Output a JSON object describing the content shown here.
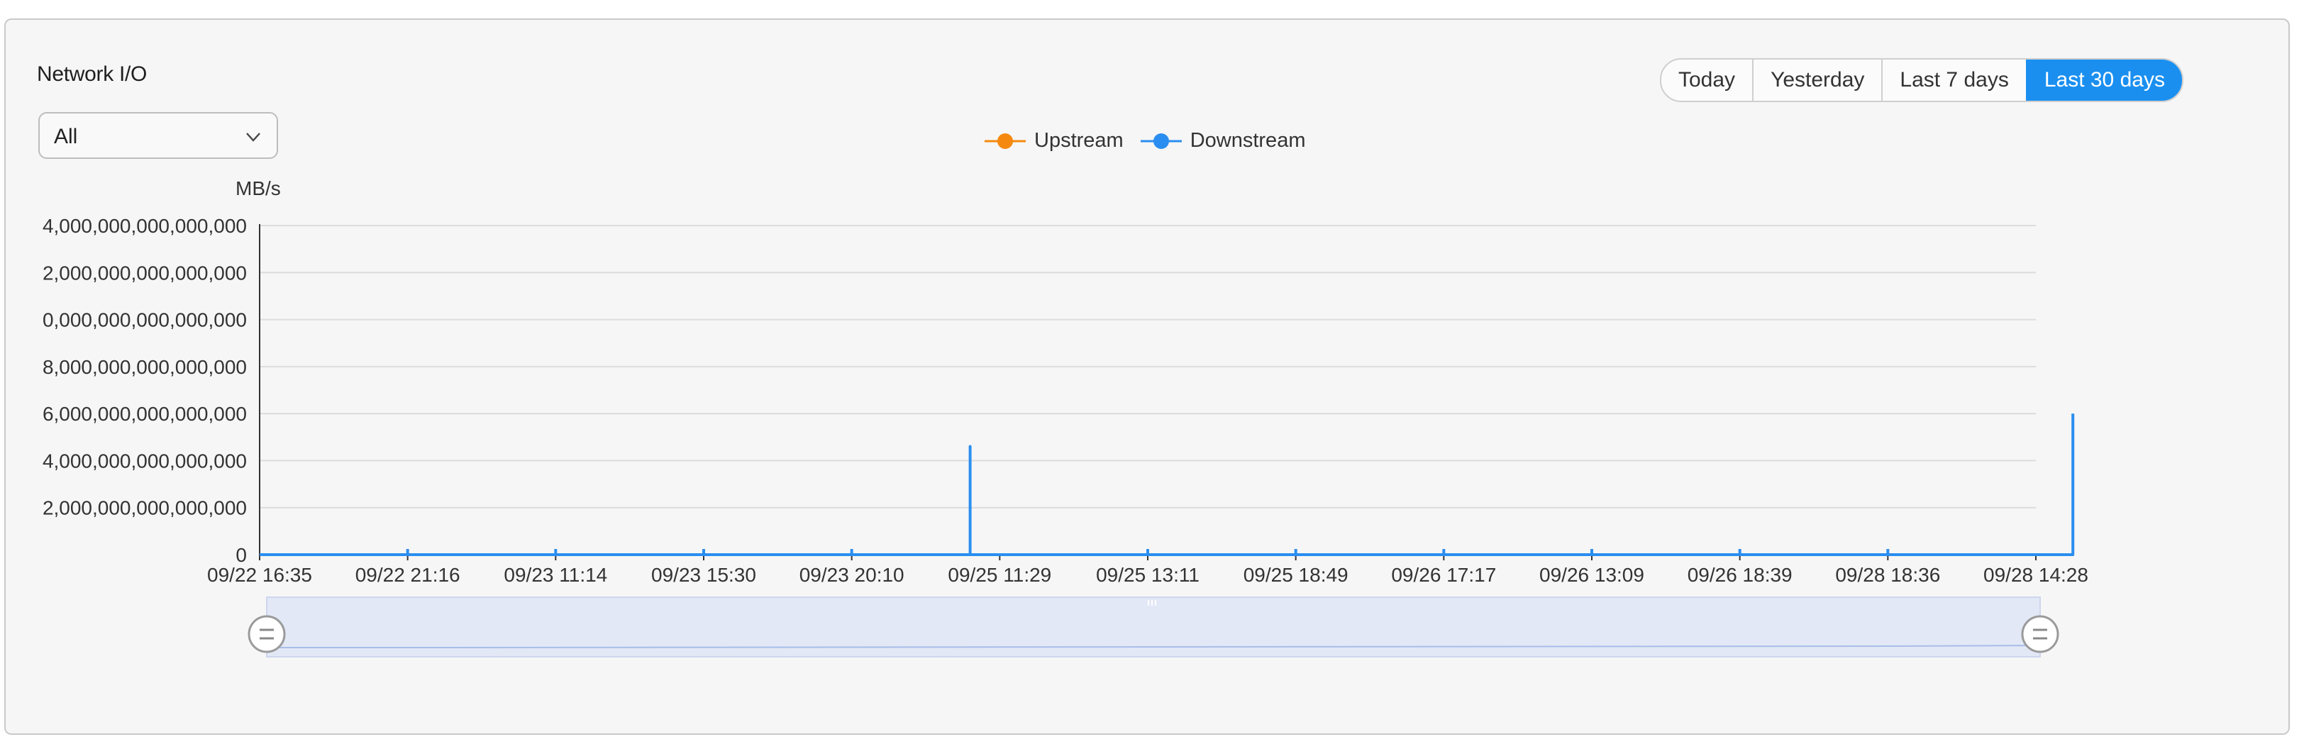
{
  "panel": {
    "title": "Network I/O",
    "filter": {
      "selected": "All"
    },
    "time_ranges": [
      {
        "label": "Today",
        "active": false
      },
      {
        "label": "Yesterday",
        "active": false
      },
      {
        "label": "Last 7 days",
        "active": false
      },
      {
        "label": "Last 30 days",
        "active": true
      }
    ]
  },
  "chart_data": {
    "type": "line",
    "unit_label": "MB/s",
    "y_tick_labels": [
      "4,000,000,000,000,000",
      "2,000,000,000,000,000",
      "0,000,000,000,000,000",
      "8,000,000,000,000,000",
      "6,000,000,000,000,000",
      "4,000,000,000,000,000",
      "2,000,000,000,000,000",
      "0"
    ],
    "x_tick_labels": [
      "09/22 16:35",
      "09/22 21:16",
      "09/23 11:14",
      "09/23 15:30",
      "09/23 20:10",
      "09/25 11:29",
      "09/25 13:11",
      "09/25 18:49",
      "09/26 17:17",
      "09/26 13:09",
      "09/26 18:39",
      "09/28 18:36",
      "09/28 14:28"
    ],
    "legend_position": "top-center",
    "grid": true,
    "ylim_levels": [
      0,
      7
    ],
    "colors": {
      "upstream": "#f5890f",
      "downstream": "#2a8ef0"
    },
    "series": [
      {
        "name": "Upstream",
        "values": []
      },
      {
        "name": "Downstream",
        "points": [
          {
            "x": 0,
            "y": 0
          },
          {
            "x": 4.8,
            "y": 0
          },
          {
            "x": 4.8,
            "y": 2.3
          },
          {
            "x": 4.8,
            "y": 0
          },
          {
            "x": 12.25,
            "y": 0
          },
          {
            "x": 12.25,
            "y": 3.0
          }
        ]
      }
    ]
  }
}
